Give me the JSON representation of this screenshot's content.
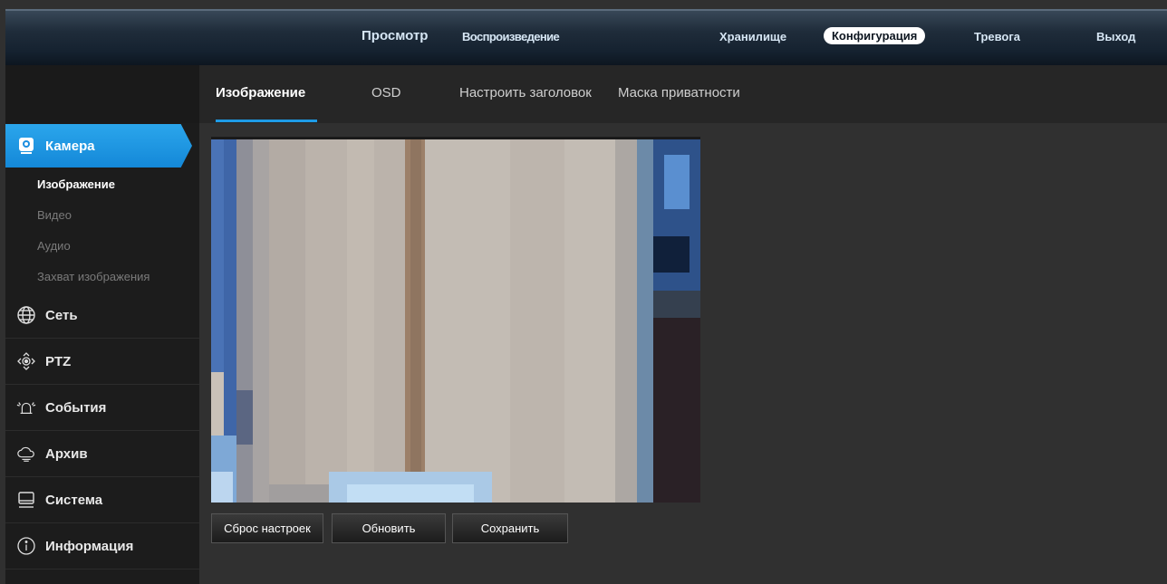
{
  "topnav": {
    "preview": "Просмотр",
    "playback": "Воспроизведение",
    "storage": "Хранилище",
    "config": "Конфигурация",
    "alarm": "Тревога",
    "exit": "Выход"
  },
  "tabs": {
    "image": "Изображение",
    "osd": "OSD",
    "title": "Настроить заголовок",
    "privacy": "Маска приватности"
  },
  "sidebar": {
    "camera": "Камера",
    "camera_items": [
      "Изображение",
      "Видео",
      "Аудио",
      "Захват изображения"
    ],
    "network": "Сеть",
    "ptz": "PTZ",
    "events": "События",
    "archive": "Архив",
    "system": "Система",
    "info": "Информация"
  },
  "buttons": {
    "reset": "Сброс настроек",
    "refresh": "Обновить",
    "save": "Сохранить"
  },
  "colors": {
    "accent": "#1e9be6",
    "topbar": "#152230",
    "background": "#303030"
  }
}
